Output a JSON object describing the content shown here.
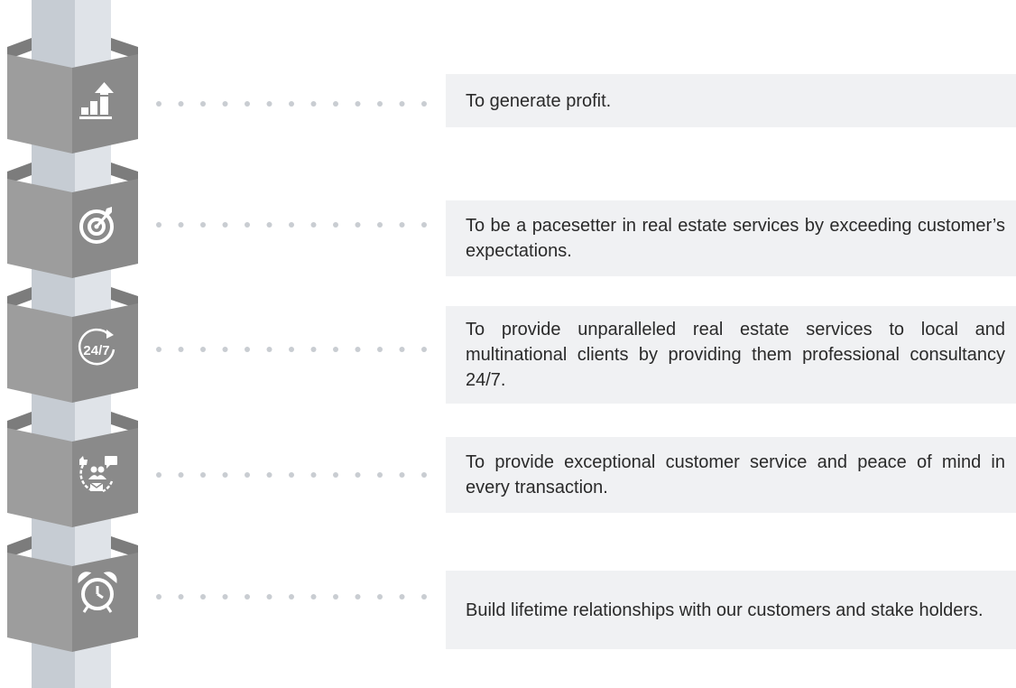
{
  "colors": {
    "pole_front": "#c6ccd3",
    "pole_side": "#dfe3e8",
    "block_front": "#9d9d9d",
    "block_top": "#7c7c7c",
    "block_side": "#8a8a8a",
    "dots": "#c9cdd2",
    "text_box": "#f0f1f3",
    "text": "#2a2a2a"
  },
  "items": [
    {
      "icon": "bar-chart-up-icon",
      "text": "To generate profit."
    },
    {
      "icon": "target-icon",
      "text": "To be a pacesetter in real estate services by exceeding customer’s expectations."
    },
    {
      "icon": "24-7-icon",
      "icon_label": "24/7",
      "text": "To provide unparalleled real estate services to local and multinational clients by providing them professional consultancy 24/7."
    },
    {
      "icon": "customer-service-icon",
      "text": "To provide exceptional customer service and peace of mind in every transaction."
    },
    {
      "icon": "alarm-clock-icon",
      "text": "Build lifetime relationships with our customers and stake holders."
    }
  ]
}
